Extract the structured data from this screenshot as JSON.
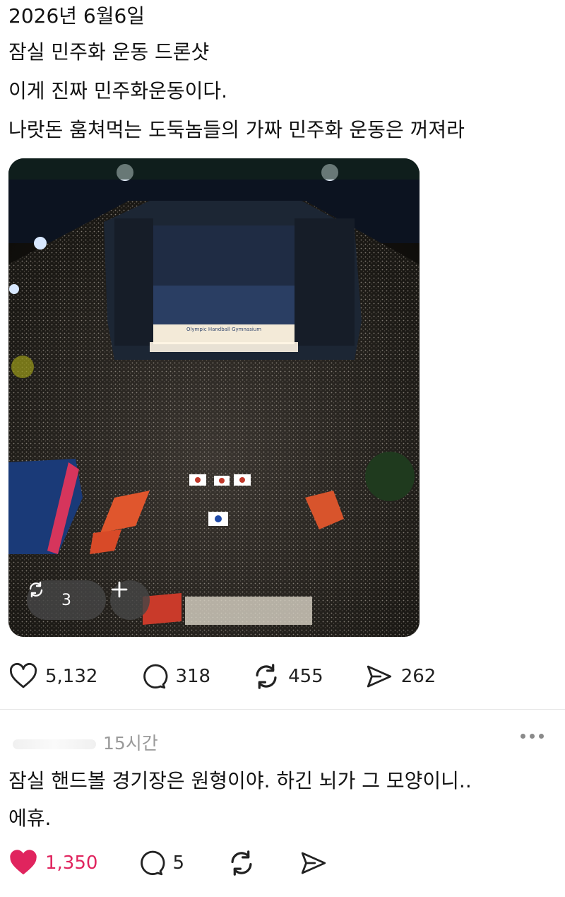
{
  "post": {
    "lines": [
      "2026년 6월6일",
      "잠실 민주화 운동 드론샷",
      "이게 진짜 민주화운동이다.",
      "나랏돈 훔쳐먹는 도둑놈들의 가짜 민주화 운동은 꺼져라"
    ],
    "photo": {
      "building_sign": "Olympic Handball Gymnasium",
      "repost_count": "3",
      "plus_icon": "plus-icon"
    },
    "actions": {
      "likes": "5,132",
      "comments": "318",
      "reposts": "455",
      "shares": "262"
    }
  },
  "comment": {
    "timestamp": "15시간",
    "lines": [
      "잠실 핸드볼 경기장은 원형이야. 하긴 뇌가 그 모양이니..",
      "에휴."
    ],
    "actions": {
      "likes": "1,350",
      "comments": "5"
    },
    "liked": true
  },
  "colors": {
    "liked_red": "#e0245e",
    "text": "#121212",
    "muted": "#9a9a9a"
  },
  "icons": [
    "heart-icon",
    "comment-icon",
    "repost-icon",
    "share-icon",
    "more-icon"
  ]
}
